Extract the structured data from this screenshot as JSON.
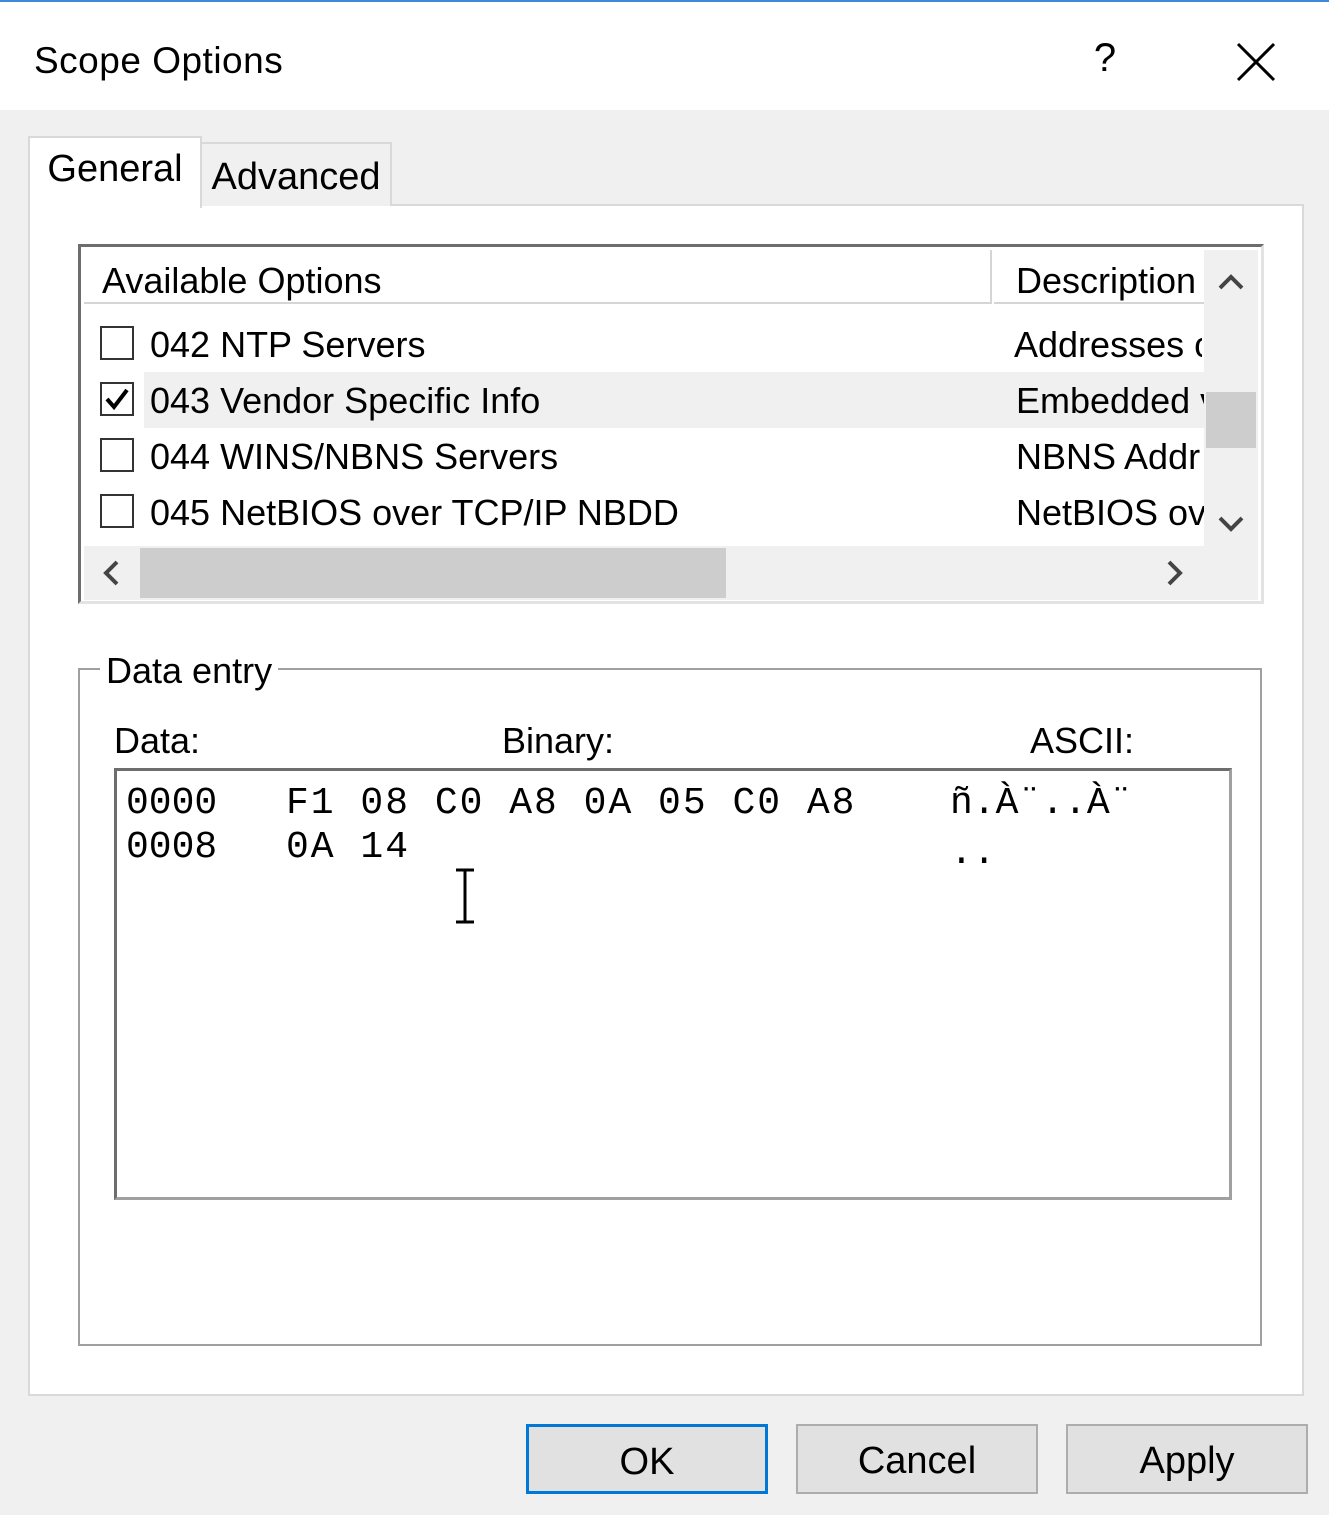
{
  "window": {
    "title": "Scope Options",
    "help_glyph": "?",
    "close_icon": "close-icon"
  },
  "tabs": [
    {
      "label": "General",
      "active": true
    },
    {
      "label": "Advanced",
      "active": false
    }
  ],
  "list": {
    "columns": [
      "Available Options",
      "Description"
    ],
    "rows": [
      {
        "checked": false,
        "label": "042 NTP Servers",
        "description": "Addresses o"
      },
      {
        "checked": true,
        "label": "043 Vendor Specific Info",
        "description": "Embedded v"
      },
      {
        "checked": false,
        "label": "044 WINS/NBNS Servers",
        "description": "NBNS Addr"
      },
      {
        "checked": false,
        "label": "045 NetBIOS over TCP/IP NBDD",
        "description": "NetBIOS ov"
      }
    ],
    "scroll_up": "^",
    "scroll_down": "v",
    "scroll_left": "<",
    "scroll_right": ">"
  },
  "data_entry": {
    "group_label": "Data entry",
    "data_label": "Data:",
    "binary_label": "Binary:",
    "ascii_label": "ASCII:",
    "lines": [
      {
        "offset": "0000",
        "hex": "F1 08 C0 A8 0A 05 C0 A8",
        "ascii": "ñ.À¨..À¨"
      },
      {
        "offset": "0008",
        "hex": "0A 14",
        "ascii": ".."
      }
    ]
  },
  "buttons": {
    "ok": "OK",
    "cancel": "Cancel",
    "apply": "Apply"
  }
}
